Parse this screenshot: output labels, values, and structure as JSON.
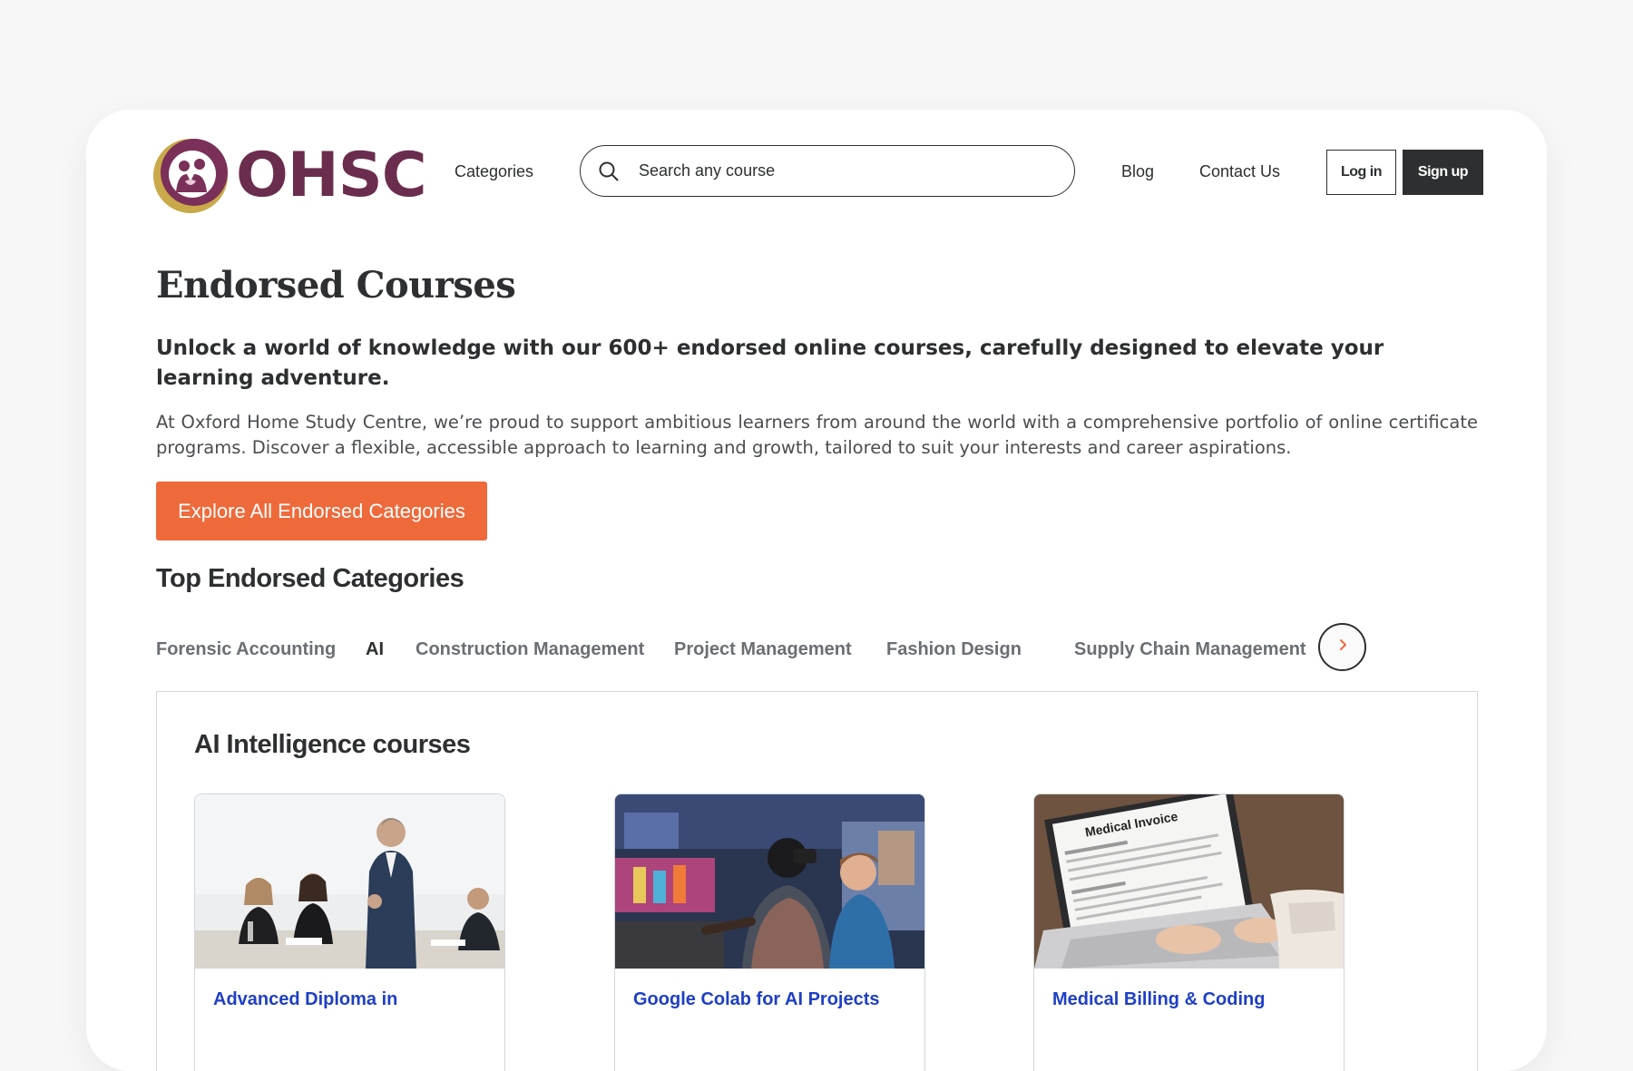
{
  "header": {
    "logo_text": "OHSC",
    "categories_label": "Categories",
    "search": {
      "placeholder": "Search any course"
    },
    "nav": {
      "blog": "Blog",
      "contact": "Contact Us"
    },
    "login_label": "Log in",
    "signup_label": "Sign up"
  },
  "hero": {
    "title": "Endorsed Courses",
    "lead": "Unlock a world of knowledge with our 600+ endorsed online courses, carefully designed to elevate your learning adventure.",
    "body": "At Oxford Home Study Centre, we’re proud to support ambitious learners from around the world with a comprehensive portfolio of online certificate programs. Discover a flexible, accessible approach to learning and growth, tailored to suit your interests and career aspirations.",
    "cta_label": "Explore All Endorsed Categories"
  },
  "top_categories": {
    "title": "Top Endorsed Categories",
    "tabs": [
      {
        "label": "Forensic Accounting",
        "active": false
      },
      {
        "label": "AI",
        "active": true
      },
      {
        "label": "Construction Management",
        "active": false
      },
      {
        "label": "Project Management",
        "active": false
      },
      {
        "label": "Fashion Design",
        "active": false
      },
      {
        "label": "Supply Chain Management",
        "active": false
      }
    ],
    "next_icon": "chevron-right-icon"
  },
  "panel": {
    "title": "AI Intelligence courses",
    "courses": [
      {
        "name": "Advanced Diploma in",
        "image": "business-meeting-photo"
      },
      {
        "name": "Google Colab for AI Projects",
        "image": "vr-lab-photo"
      },
      {
        "name": "Medical Billing & Coding",
        "image": "medical-invoice-laptop-photo",
        "image_text": "Medical Invoice"
      }
    ]
  },
  "colors": {
    "accent": "#ee6a3b",
    "dark": "#2d2f31",
    "link": "#1e3fc5",
    "brand": "#6b2d4d",
    "logo_gold": "#c9a94a"
  }
}
